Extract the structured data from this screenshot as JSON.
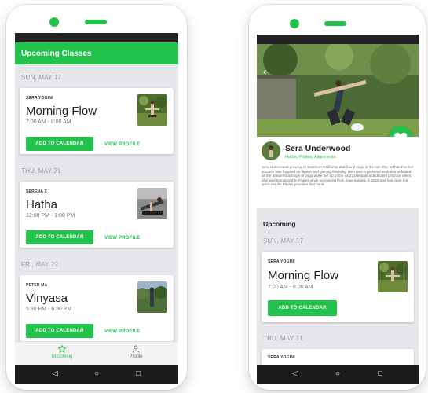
{
  "left": {
    "appbar_title": "Upcoming Classes",
    "sections": [
      {
        "date": "SUN, MAY 17",
        "instructor": "SERA YOGINI",
        "class_name": "Morning Flow",
        "time": "7:00 AM - 8:00 AM",
        "add_label": "ADD TO CALENDAR",
        "profile_label": "VIEW PROFILE"
      },
      {
        "date": "THU, MAY 21",
        "instructor": "SERENA X",
        "class_name": "Hatha",
        "time": "12:00 PM - 1:00 PM",
        "add_label": "ADD TO CALENDAR",
        "profile_label": "VIEW PROFILE"
      },
      {
        "date": "FRI, MAY 22",
        "instructor": "PETER MA",
        "class_name": "Vinyasa",
        "time": "5:30 PM - 6:30 PM",
        "add_label": "ADD TO CALENDAR",
        "profile_label": "VIEW PROFILE"
      }
    ],
    "nav": {
      "upcoming_label": "Upcoming",
      "profile_label": "Profile"
    }
  },
  "right": {
    "name": "Sera Underwood",
    "styles": "Hatha, Pilates, Alignments",
    "bio": "Sera Underwood grew up in Southern California and found yoga in the late 90s, at that time her practice was focused on fitness and gaining flexibility. With time a personal evolution unfolded as the deeper teachings of yoga woke her up to the vast potentials a dedicated practice offers. She was introduced to Pilates while recovering from knee surgery in 2010 and has seen the quick results Pilates provides first hand.",
    "upcoming_title": "Upcoming",
    "sections": [
      {
        "date": "SUN, MAY 17",
        "instructor": "SERA YOGINI",
        "class_name": "Morning Flow",
        "time": "7:00 AM - 8:00 AM",
        "add_label": "ADD TO CALENDAR"
      },
      {
        "date": "THU, MAY 21",
        "instructor": "SERA YOGINI"
      }
    ]
  },
  "colors": {
    "accent": "#22c24d",
    "background": "#e6e7ea",
    "statusbar": "#222222"
  },
  "icons": {
    "back": "chevron-left-icon",
    "favorite": "heart-icon",
    "upcoming": "star-icon",
    "profile": "person-icon",
    "sys_back": "triangle-back-icon",
    "sys_home": "circle-home-icon",
    "sys_recent": "square-recent-icon"
  }
}
